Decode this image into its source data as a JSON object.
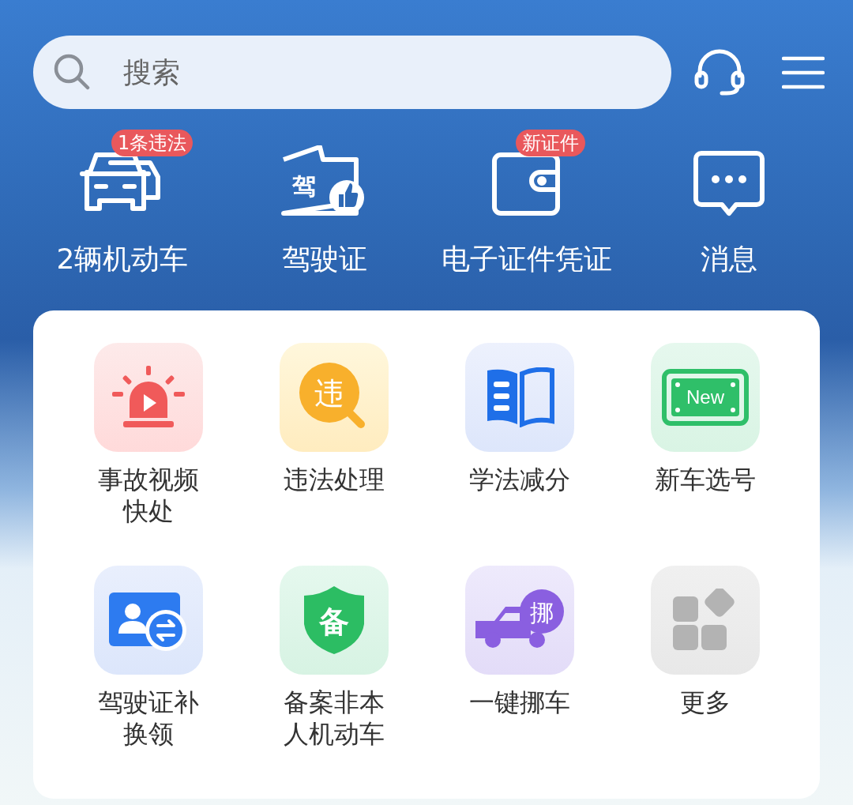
{
  "search": {
    "placeholder": "搜索"
  },
  "quick_links": [
    {
      "kind": "car",
      "label": "2辆机动车",
      "badge": "1条违法"
    },
    {
      "kind": "license",
      "label": "驾驶证",
      "icon_text": "驾"
    },
    {
      "kind": "wallet",
      "label": "电子证件凭证",
      "badge": "新证件"
    },
    {
      "kind": "message",
      "label": "消息"
    }
  ],
  "services": [
    {
      "kind": "alarm",
      "label": "事故视频快处"
    },
    {
      "kind": "violation",
      "label": "违法处理",
      "icon_text": "违"
    },
    {
      "kind": "book",
      "label": "学法减分"
    },
    {
      "kind": "plate",
      "label": "新车选号",
      "icon_text": "New"
    },
    {
      "kind": "renew",
      "label": "驾驶证补换领"
    },
    {
      "kind": "shield",
      "label": "备案非本人机动车",
      "icon_text": "备"
    },
    {
      "kind": "truck",
      "label": "一键挪车",
      "icon_text": "挪"
    },
    {
      "kind": "more",
      "label": "更多"
    }
  ]
}
